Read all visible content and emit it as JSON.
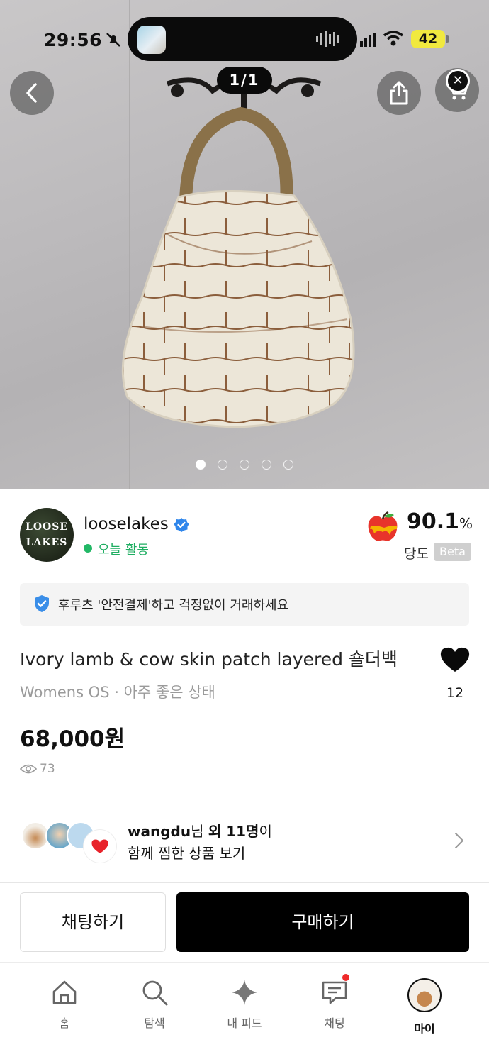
{
  "status_bar": {
    "time": "29:56",
    "battery": "42"
  },
  "hero": {
    "counter": "1/1",
    "current_slide": 1,
    "slide_count": 5
  },
  "seller": {
    "name": "looselakes",
    "avatar_text_line1": "LOOSE",
    "avatar_text_line2": "LAKES",
    "activity": "오늘 활동",
    "rating_value": "90.1",
    "rating_unit": "%",
    "rating_label": "당도",
    "rating_badge": "Beta"
  },
  "safe_payment": {
    "text": "후루츠 '안전결제'하고 걱정없이 거래하세요"
  },
  "product": {
    "title": "Ivory lamb & cow skin patch layered 숄더백",
    "subtitle": "Womens OS · 아주 좋은 상태",
    "price": "68,000원",
    "views": "73",
    "likes": "12"
  },
  "wishers": {
    "user": "wangdu",
    "suffix_nim": "님 ",
    "others": "외 11명",
    "suffix_i": "이",
    "line2": "함께 찜한 상품 보기"
  },
  "actions": {
    "chat_label": "채팅하기",
    "buy_label": "구매하기"
  },
  "tabbar": {
    "items": [
      {
        "label": "홈",
        "icon": "home-icon"
      },
      {
        "label": "탐색",
        "icon": "search-icon"
      },
      {
        "label": "내 피드",
        "icon": "sparkle-icon"
      },
      {
        "label": "채팅",
        "icon": "chat-icon"
      },
      {
        "label": "마이",
        "icon": "profile-avatar"
      }
    ]
  },
  "colors": {
    "accent_green": "#1fae62",
    "verified_blue": "#2f86eb",
    "notification_red": "#ef2b2b"
  }
}
